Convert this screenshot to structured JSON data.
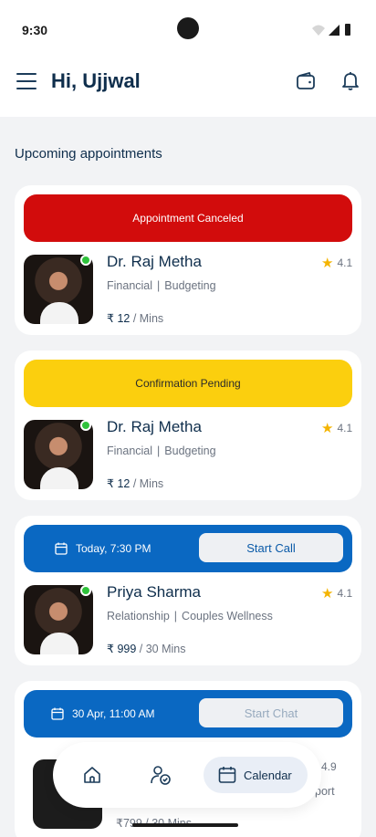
{
  "status_bar": {
    "time": "9:30"
  },
  "header": {
    "greeting": "Hi, Ujjwal"
  },
  "section_title": "Upcoming appointments",
  "currency": "₹",
  "appointments": [
    {
      "banner": "Appointment Canceled",
      "name": "Dr. Raj Metha",
      "rating": "4.1",
      "tags": [
        "Financial",
        "Budgeting"
      ],
      "price": "12",
      "unit": "Mins"
    },
    {
      "banner": "Confirmation Pending",
      "name": "Dr. Raj Metha",
      "rating": "4.1",
      "tags": [
        "Financial",
        "Budgeting"
      ],
      "price": "12",
      "unit": "Mins"
    },
    {
      "date": "Today, 7:30 PM",
      "action": "Start Call",
      "name": "Priya Sharma",
      "rating": "4.1",
      "tags": [
        "Relationship",
        "Couples Wellness"
      ],
      "price": "999",
      "unit": "30 Mins"
    },
    {
      "date": "30 Apr, 11:00 AM",
      "action": "Start Chat",
      "rating": "4.9",
      "tag_partial": "port",
      "price": "799",
      "unit": "30 Mins"
    }
  ],
  "bottom_nav": {
    "active_label": "Calendar"
  },
  "colors": {
    "canceled": "#d20c0c",
    "pending": "#fbcf0e",
    "scheduled": "#0a68c2",
    "online": "#2fc23b",
    "star": "#f4b400"
  },
  "icons": [
    "menu-icon",
    "wallet-icon",
    "bell-icon",
    "calendar-icon",
    "star-icon",
    "home-icon",
    "consultant-icon"
  ]
}
